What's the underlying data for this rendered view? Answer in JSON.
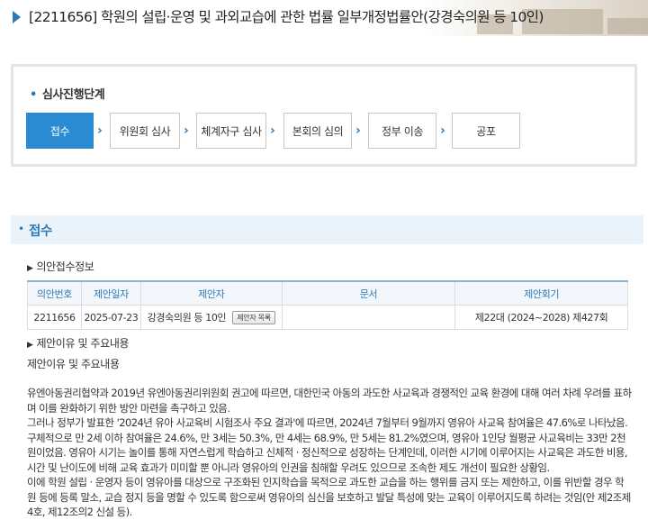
{
  "header": {
    "title": "[2211656] 학원의 설립·운영 및 과외교습에 관한 법률 일부개정법률안(강경숙의원 등 10인)"
  },
  "progress": {
    "title": "심사진행단계",
    "steps": [
      {
        "label": "접수",
        "active": true
      },
      {
        "label": "위원회 심사",
        "active": false
      },
      {
        "label": "체계자구 심사",
        "active": false
      },
      {
        "label": "본회의 심의",
        "active": false
      },
      {
        "label": "정부 이송",
        "active": false
      },
      {
        "label": "공포",
        "active": false
      }
    ]
  },
  "section": {
    "title": "접수",
    "info_heading": "의안접수정보",
    "table": {
      "headers": [
        "의안번호",
        "제안일자",
        "제안자",
        "문서",
        "제안회기"
      ],
      "row": {
        "bill_no": "2211656",
        "date": "2025-07-23",
        "proposer": "강경숙의원 등 10인",
        "proposer_button": "제안자 목록",
        "document": "",
        "session": "제22대 (2024~2028) 제427회"
      }
    },
    "reason_heading": "제안이유 및 주요내용",
    "reason_label": "제안이유 및 주요내용",
    "paragraphs": [
      "유엔아동권리협약과 2019년 유엔아동권리위원회 권고에 따르면, 대한민국 아동의 과도한 사교육과 경쟁적인 교육 환경에 대해 여러 차례 우려를 표하며 이를 완화하기 위한 방안 마련을 촉구하고 있음.",
      "그러나 정부가 발표한 '2024년 유아 사교육비 시험조사 주요 결과'에 따르면, 2024년 7월부터 9월까지 영유아 사교육 참여율은 47.6%로 나타났음. 구체적으로 만 2세 이하 참여율은 24.6%, 만 3세는 50.3%, 만 4세는 68.9%, 만 5세는 81.2%였으며, 영유아 1인당 월평균 사교육비는 33만 2천원이었음. 영유아 시기는 놀이를 통해 자연스럽게 학습하고 신체적 · 정신적으로 성장하는 단계인데, 이러한 시기에 이루어지는 사교육은 과도한 비용, 시간 및 난이도에 비해 교육 효과가 미미할 뿐 아니라 영유아의 인권을 침해할 우려도 있으므로 조속한 제도 개선이 필요한 상황임.",
      "이에 학원 설립 · 운영자 등이 영유아를 대상으로 구조화된 인지학습을 목적으로 과도한 교습을 하는 행위를 금지 또는 제한하고, 이를 위반할 경우 학원 등에 등록 말소, 교습 정지 등을 명할 수 있도록 함으로써 영유아의 심신을 보호하고 발달 특성에 맞는 교육이 이루어지도록 하려는 것임(안 제2조제4호, 제12조의2 신설 등)."
    ]
  },
  "colors": {
    "accent": "#2a7ab8",
    "active_step": "#2a8bd2"
  }
}
